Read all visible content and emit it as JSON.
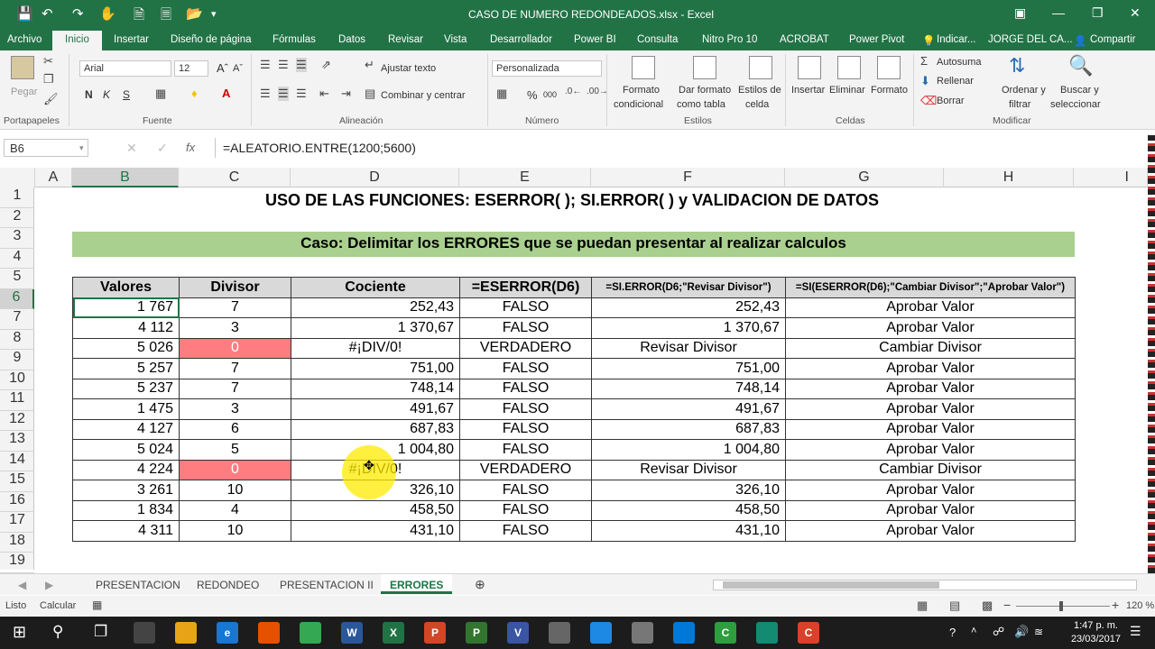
{
  "app": {
    "title": "CASO DE NUMERO REDONDEADOS.xlsx - Excel",
    "qa_icons": [
      "save-icon",
      "undo-icon",
      "redo-icon",
      "touch-mode-icon",
      "new-file-icon",
      "open-file-icon",
      "customize-icon"
    ]
  },
  "tabs": [
    "Archivo",
    "Inicio",
    "Insertar",
    "Diseño de página",
    "Fórmulas",
    "Datos",
    "Revisar",
    "Vista",
    "Desarrollador",
    "Power BI",
    "Consulta",
    "Nitro Pro 10",
    "ACROBAT",
    "Power Pivot"
  ],
  "tabs_right": {
    "tell_me": "Indicar...",
    "user": "JORGE DEL CA...",
    "share": "Compartir"
  },
  "ribbon": {
    "paste": "Pegar",
    "font_name": "Arial",
    "font_size": "12",
    "bold": "N",
    "italic": "K",
    "underline": "S",
    "wrap_text": "Ajustar texto",
    "merge": "Combinar y centrar",
    "number_format": "Personalizada",
    "percent": "%",
    "thousands": "000",
    "cond_format": [
      "Formato",
      "condicional"
    ],
    "format_table": [
      "Dar formato",
      "como tabla"
    ],
    "cell_styles": [
      "Estilos de",
      "celda"
    ],
    "insert": "Insertar",
    "delete": "Eliminar",
    "format": "Formato",
    "autosum": "Autosuma",
    "fill": "Rellenar",
    "clear": "Borrar",
    "sort": [
      "Ordenar y",
      "filtrar"
    ],
    "find": [
      "Buscar y",
      "seleccionar"
    ],
    "groups": [
      "Portapapeles",
      "Fuente",
      "Alineación",
      "Número",
      "Estilos",
      "Celdas",
      "Modificar"
    ]
  },
  "formula_bar": {
    "name_box": "B6",
    "fx": "fx",
    "formula": "=ALEATORIO.ENTRE(1200;5600)"
  },
  "columns": [
    "A",
    "B",
    "C",
    "D",
    "E",
    "F",
    "G",
    "H",
    "I"
  ],
  "rows": [
    "1",
    "2",
    "3",
    "4",
    "5",
    "6",
    "7",
    "8",
    "9",
    "10",
    "11",
    "12",
    "13",
    "14",
    "15",
    "16",
    "17",
    "18",
    "19"
  ],
  "sheet": {
    "title": "USO DE LAS FUNCIONES: ESERROR( );  SI.ERROR( ) y VALIDACION DE DATOS",
    "subtitle": "Caso: Delimitar los ERRORES que se puedan presentar al realizar calculos",
    "headers": [
      "Valores",
      "Divisor",
      "Cociente",
      "=ESERROR(D6)",
      "=SI.ERROR(D6;\"Revisar Divisor\")",
      "=SI(ESERROR(D6);\"Cambiar Divisor\";\"Aprobar Valor\")"
    ],
    "data": [
      [
        "1 767",
        "7",
        "252,43",
        "FALSO",
        "252,43",
        "Aprobar Valor"
      ],
      [
        "4 112",
        "3",
        "1 370,67",
        "FALSO",
        "1 370,67",
        "Aprobar Valor"
      ],
      [
        "5 026",
        "0",
        "#¡DIV/0!",
        "VERDADERO",
        "Revisar Divisor",
        "Cambiar Divisor"
      ],
      [
        "5 257",
        "7",
        "751,00",
        "FALSO",
        "751,00",
        "Aprobar Valor"
      ],
      [
        "5 237",
        "7",
        "748,14",
        "FALSO",
        "748,14",
        "Aprobar Valor"
      ],
      [
        "1 475",
        "3",
        "491,67",
        "FALSO",
        "491,67",
        "Aprobar Valor"
      ],
      [
        "4 127",
        "6",
        "687,83",
        "FALSO",
        "687,83",
        "Aprobar Valor"
      ],
      [
        "5 024",
        "5",
        "1 004,80",
        "FALSO",
        "1 004,80",
        "Aprobar Valor"
      ],
      [
        "4 224",
        "0",
        "#¡DIV/0!",
        "VERDADERO",
        "Revisar Divisor",
        "Cambiar Divisor"
      ],
      [
        "3 261",
        "10",
        "326,10",
        "FALSO",
        "326,10",
        "Aprobar Valor"
      ],
      [
        "1 834",
        "4",
        "458,50",
        "FALSO",
        "458,50",
        "Aprobar Valor"
      ],
      [
        "4 311",
        "10",
        "431,10",
        "FALSO",
        "431,10",
        "Aprobar Valor"
      ]
    ],
    "colors": {
      "band": "#a9d08e",
      "zero_fill": "#ff7c80",
      "header_fill": "#d9d9d9"
    }
  },
  "sheet_tabs": [
    "PRESENTACION",
    "REDONDEO",
    "PRESENTACION II",
    "ERRORES"
  ],
  "status": {
    "ready": "Listo",
    "calc": "Calcular",
    "zoom": "120 %"
  },
  "taskbar": {
    "time": "1:47 p. m.",
    "date": "23/03/2017",
    "apps": [
      {
        "label": "",
        "color": "#444"
      },
      {
        "label": "",
        "color": "#e8a317"
      },
      {
        "label": "e",
        "color": "#1976d2"
      },
      {
        "label": "",
        "color": "#e65100"
      },
      {
        "label": "",
        "color": "#34a853"
      },
      {
        "label": "W",
        "color": "#2b579a"
      },
      {
        "label": "X",
        "color": "#217346"
      },
      {
        "label": "P",
        "color": "#d24726"
      },
      {
        "label": "P",
        "color": "#31752f"
      },
      {
        "label": "V",
        "color": "#3955a3"
      },
      {
        "label": "",
        "color": "#666"
      },
      {
        "label": "",
        "color": "#1e88e5"
      },
      {
        "label": "",
        "color": "#777"
      },
      {
        "label": "",
        "color": "#0078d7"
      },
      {
        "label": "C",
        "color": "#2e9e3e"
      },
      {
        "label": "",
        "color": "#138a72"
      },
      {
        "label": "C",
        "color": "#d9412b"
      }
    ]
  }
}
